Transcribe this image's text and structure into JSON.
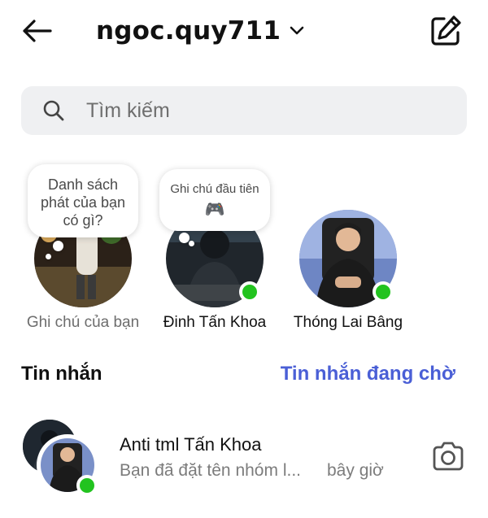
{
  "header": {
    "username": "ngoc.quy711",
    "back_icon": "arrow-left-icon",
    "dropdown_icon": "chevron-down-icon",
    "compose_icon": "edit-square-icon"
  },
  "search": {
    "placeholder": "Tìm kiếm",
    "icon": "search-icon"
  },
  "notes": [
    {
      "note_line1": "Danh sách",
      "note_line2": "phát của bạn",
      "note_line3": "có gì?",
      "name": "Ghi chú của bạn",
      "online": false
    },
    {
      "note_line1": "Ghi chú đầu tiên",
      "note_emoji": "🎮",
      "name": "Đinh Tấn Khoa",
      "online": true
    },
    {
      "name": "Thóng Lai Bâng",
      "online": true
    }
  ],
  "sections": {
    "messages_label": "Tin nhắn",
    "requests_label": "Tin nhắn đang chờ"
  },
  "threads": [
    {
      "name": "Anti tml Tấn Khoa",
      "preview": "Bạn đã đặt tên nhóm l...",
      "time": "bây giờ",
      "online": true,
      "action_icon": "camera-icon"
    }
  ],
  "colors": {
    "accent": "#4a5fd6",
    "online": "#22c31f",
    "search_bg": "#eff0f2",
    "secondary_text": "#7c7c7c"
  }
}
